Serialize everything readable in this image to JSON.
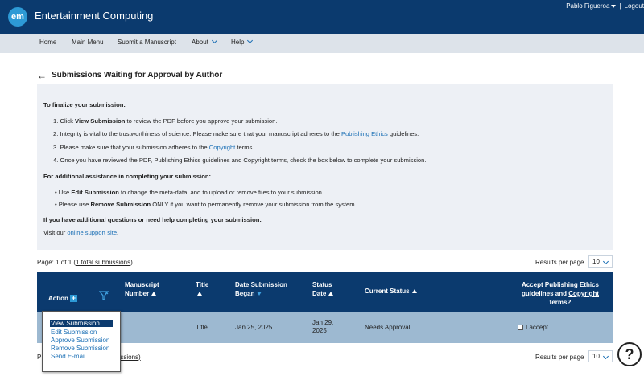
{
  "header": {
    "logo": "em",
    "journal_title": "Entertainment Computing",
    "user_name": "Pablo Figueroa",
    "logout": "Logout"
  },
  "nav": {
    "home": "Home",
    "main_menu": "Main Menu",
    "submit": "Submit a Manuscript",
    "about": "About",
    "help": "Help"
  },
  "page": {
    "back_arrow": "←",
    "title": "Submissions Waiting for Approval by Author"
  },
  "instructions": {
    "finalize_heading": "To finalize your submission:",
    "step1_num": "1.",
    "step1_pre": "Click ",
    "step1_bold": "View Submission",
    "step1_post": " to review the PDF before you approve your submission.",
    "step2_num": "2.",
    "step2_pre": "Integrity is vital to the trustworthiness of science. Please make sure that your manuscript adheres to the ",
    "step2_link": "Publishing Ethics",
    "step2_post": " guidelines.",
    "step3_num": "3.",
    "step3_pre": "Please make sure that your submission adheres to the ",
    "step3_link": "Copyright",
    "step3_post": " terms.",
    "step4_num": "4.",
    "step4": "Once you have reviewed the PDF, Publishing Ethics guidelines and Copyright terms, check the box below to complete your submission.",
    "assist_heading": "For additional assistance in completing your submission:",
    "bullet1_pre": "Use ",
    "bullet1_bold": "Edit Submission",
    "bullet1_post": " to change the meta-data, and to upload or remove files to your submission.",
    "bullet2_pre": "Please use ",
    "bullet2_bold": "Remove Submission",
    "bullet2_post": " ONLY if you want to permanently remove your submission from the system.",
    "questions_heading": "If you have additional questions or need help completing your submission:",
    "visit_pre": "Visit our ",
    "visit_link": "online support site",
    "visit_post": "."
  },
  "paging": {
    "page_info_pre": "Page: 1 of 1 (",
    "page_info_link": "1 total submissions",
    "page_info_post": ")",
    "bottom_prefix": "P",
    "bottom_suffix": "ssions)",
    "rpp_label": "Results per page",
    "rpp_value": "10"
  },
  "table": {
    "headers": {
      "action": "Action",
      "manuscript_number_1": "Manuscript",
      "manuscript_number_2": "Number",
      "title": "Title",
      "date_began_1": "Date Submission",
      "date_began_2": "Began",
      "status_date_1": "Status",
      "status_date_2": "Date",
      "current_status": "Current Status",
      "accept_1": "Accept ",
      "accept_link1": "Publishing Ethics",
      "accept_2": "guidelines and ",
      "accept_link2": "Copyright",
      "accept_3": "terms?"
    },
    "rows": [
      {
        "title": "Title",
        "date_began": "Jan 25, 2025",
        "status_date_1": "Jan 29,",
        "status_date_2": "2025",
        "current_status": "Needs Approval",
        "accept_label": "I accept"
      }
    ]
  },
  "action_menu": {
    "items": [
      "View Submission",
      "Edit Submission",
      "Approve Submission",
      "Remove Submission",
      "Send E-mail"
    ]
  },
  "help_button": "?",
  "colors": {
    "header_bg": "#0b3a6e",
    "nav_bg": "#dde3ea",
    "panel_bg": "#edf0f5",
    "row_bg": "#9db9d1",
    "link": "#1a6fb5"
  }
}
